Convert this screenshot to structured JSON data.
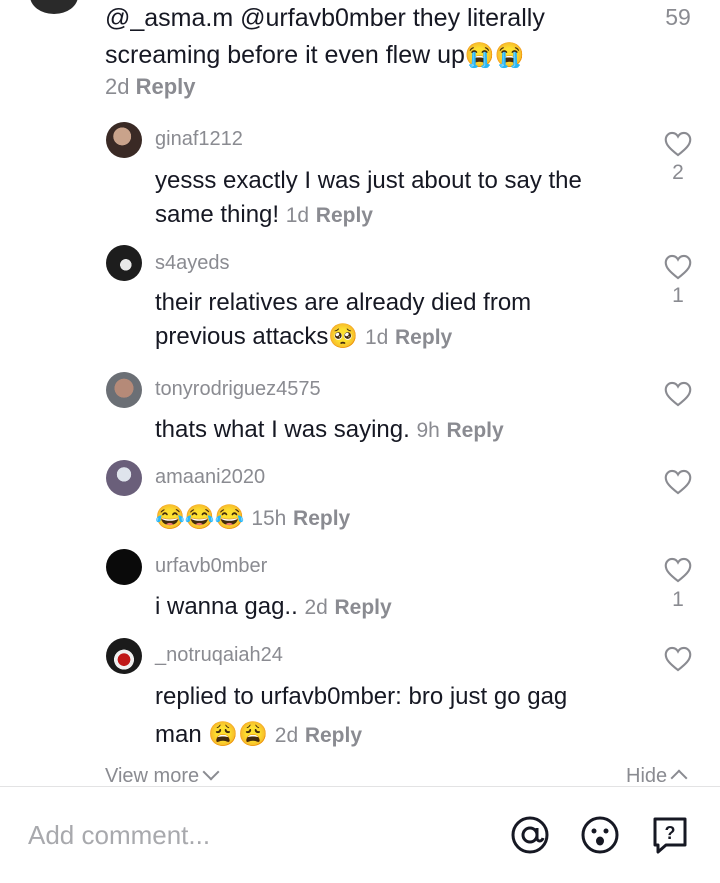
{
  "top_comment": {
    "mention1": "@_asma.m",
    "mention2": "@urfavb0mber",
    "text": "they literally screaming before it even flew up",
    "emoji": "😭😭",
    "time": "2d",
    "reply_label": "Reply",
    "like_count": "59"
  },
  "comments": [
    {
      "username": "ginaf1212",
      "text": "yesss exactly I was just about to say the same thing!",
      "emoji": "",
      "time": "1d",
      "reply_label": "Reply",
      "likes": "2"
    },
    {
      "username": "s4ayeds",
      "text": "their relatives are already died from previous attacks",
      "emoji": "🥺",
      "time": "1d",
      "reply_label": "Reply",
      "likes": "1"
    },
    {
      "username": "tonyrodriguez4575",
      "text": "thats what I was saying.",
      "emoji": "",
      "time": "9h",
      "reply_label": "Reply",
      "likes": ""
    },
    {
      "username": "amaani2020",
      "text": "",
      "emoji": "😂😂😂",
      "time": "15h",
      "reply_label": "Reply",
      "likes": ""
    },
    {
      "username": "urfavb0mber",
      "text": "i wanna gag..",
      "emoji": "",
      "time": "2d",
      "reply_label": "Reply",
      "likes": "1"
    },
    {
      "username": "_notruqaiah24",
      "prefix": "replied to",
      "reply_to": "urfavb0mber",
      "text": "bro just go gag man",
      "emoji": "😩😩",
      "time": "2d",
      "reply_label": "Reply",
      "likes": ""
    }
  ],
  "footer": {
    "view_more": "View more",
    "hide": "Hide"
  },
  "input": {
    "placeholder": "Add comment...",
    "icons": [
      "at-icon",
      "emoji-icon",
      "question-icon"
    ]
  },
  "colors": {
    "text": "#161823",
    "meta": "#8a8b91",
    "divider": "#e3e3e4"
  }
}
